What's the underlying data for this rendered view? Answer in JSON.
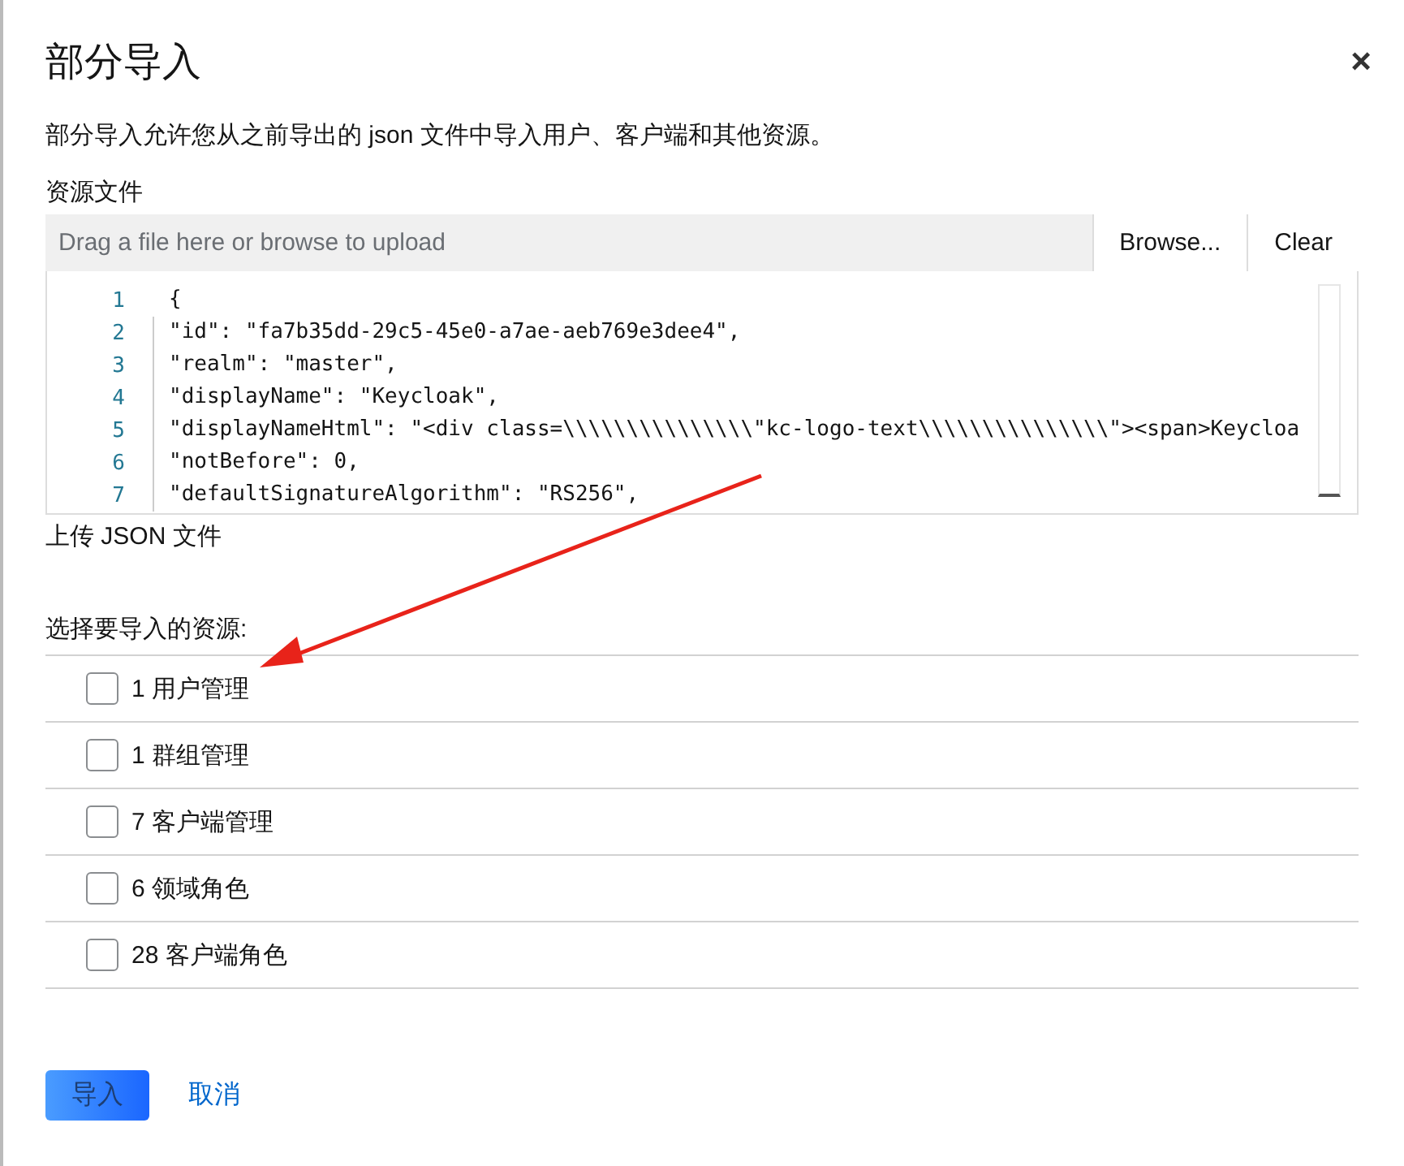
{
  "dialog": {
    "title": "部分导入",
    "close": "×",
    "description": "部分导入允许您从之前导出的 json 文件中导入用户、客户端和其他资源。"
  },
  "resource_file": {
    "label": "资源文件",
    "placeholder": "Drag a file here or browse to upload",
    "browse": "Browse...",
    "clear": "Clear",
    "code_lines": [
      {
        "number": "1",
        "text": "{",
        "children": [
          {
            "number": "2",
            "text": "\"id\": \"fa7b35dd-29c5-45e0-a7ae-aeb769e3dee4\","
          },
          {
            "number": "3",
            "text": "\"realm\": \"master\","
          },
          {
            "number": "4",
            "text": "\"displayName\": \"Keycloak\","
          },
          {
            "number": "5",
            "text": "\"displayNameHtml\": \"<div class=\\\\\\\\\\\\\\\\\\\\\\\\\\\\\\\"kc-logo-text\\\\\\\\\\\\\\\\\\\\\\\\\\\\\\\"><span>Keycloa"
          },
          {
            "number": "6",
            "text": "\"notBefore\": 0,"
          },
          {
            "number": "7",
            "text": "\"defaultSignatureAlgorithm\": \"RS256\","
          }
        ]
      }
    ],
    "helper": "上传 JSON 文件"
  },
  "resources": {
    "label": "选择要导入的资源:",
    "items": [
      {
        "label": "1 用户管理",
        "checked": false
      },
      {
        "label": "1 群组管理",
        "checked": false
      },
      {
        "label": "7 客户端管理",
        "checked": false
      },
      {
        "label": "6 领域角色",
        "checked": false
      },
      {
        "label": "28 客户端角色",
        "checked": false
      }
    ]
  },
  "buttons": {
    "import": {
      "label": "导入",
      "disabled": true
    },
    "cancel": "取消"
  }
}
